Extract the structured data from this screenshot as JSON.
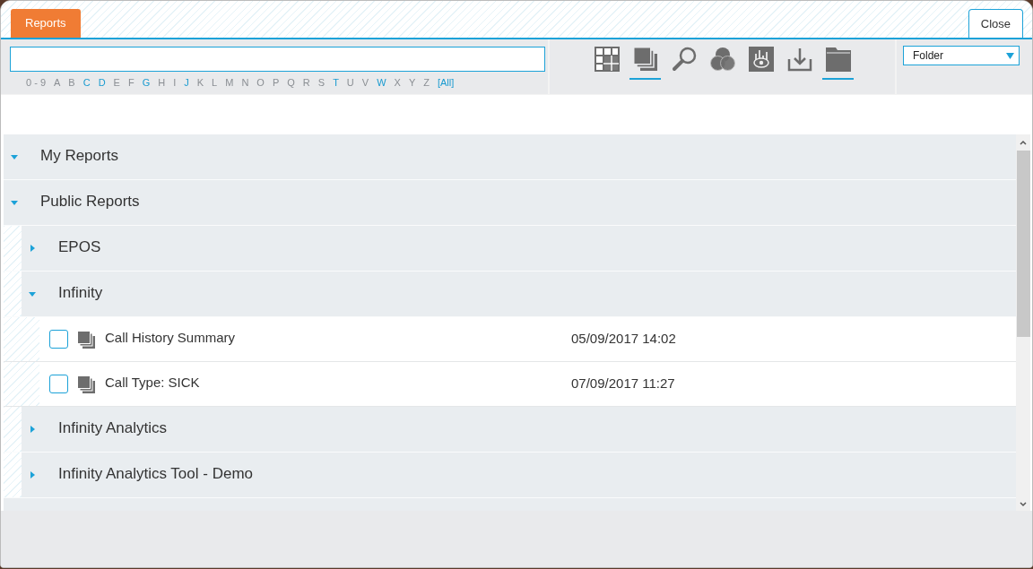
{
  "tabs": [
    {
      "label": "Reports",
      "selected": true
    }
  ],
  "close_button": "Close",
  "alphabet": [
    {
      "label": "0 - 9",
      "disabled": true
    },
    {
      "label": "A",
      "disabled": true
    },
    {
      "label": "B",
      "disabled": true
    },
    {
      "label": "C",
      "disabled": false
    },
    {
      "label": "D",
      "disabled": false
    },
    {
      "label": "E",
      "disabled": true
    },
    {
      "label": "F",
      "disabled": true
    },
    {
      "label": "G",
      "disabled": false
    },
    {
      "label": "H",
      "disabled": true
    },
    {
      "label": "I",
      "disabled": true
    },
    {
      "label": "J",
      "disabled": false
    },
    {
      "label": "K",
      "disabled": true
    },
    {
      "label": "L",
      "disabled": true
    },
    {
      "label": "M",
      "disabled": true
    },
    {
      "label": "N",
      "disabled": true
    },
    {
      "label": "O",
      "disabled": true
    },
    {
      "label": "P",
      "disabled": true
    },
    {
      "label": "Q",
      "disabled": true
    },
    {
      "label": "R",
      "disabled": true
    },
    {
      "label": "S",
      "disabled": true
    },
    {
      "label": "T",
      "disabled": false
    },
    {
      "label": "U",
      "disabled": true
    },
    {
      "label": "V",
      "disabled": true
    },
    {
      "label": "W",
      "disabled": false
    },
    {
      "label": "X",
      "disabled": true
    },
    {
      "label": "Y",
      "disabled": true
    },
    {
      "label": "Z",
      "disabled": true
    },
    {
      "label": "[All]",
      "disabled": false
    }
  ],
  "toolbar": [
    {
      "kind": "grid",
      "selected": false
    },
    {
      "kind": "stack",
      "selected": true
    },
    {
      "kind": "search",
      "selected": false
    },
    {
      "kind": "venn",
      "selected": false
    },
    {
      "kind": "eye",
      "selected": false
    },
    {
      "kind": "download",
      "selected": false
    },
    {
      "kind": "folder",
      "selected": true
    }
  ],
  "view_select": {
    "value": "Folder"
  },
  "tree": [
    {
      "kind": "folder",
      "label": "My Reports",
      "expanded": true
    },
    {
      "kind": "folder",
      "label": "Public Reports",
      "expanded": true,
      "children": [
        {
          "kind": "folder",
          "label": "EPOS",
          "expanded": false
        },
        {
          "kind": "folder",
          "label": "Infinity",
          "expanded": true,
          "children": [
            {
              "kind": "report",
              "label": "Call History Summary",
              "date": "05/09/2017 14:02",
              "checked": false
            },
            {
              "kind": "report",
              "label": "Call Type: SICK",
              "date": "07/09/2017 11:27",
              "checked": false
            }
          ]
        },
        {
          "kind": "folder",
          "label": "Infinity Analytics",
          "expanded": false
        },
        {
          "kind": "folder",
          "label": "Infinity Analytics Tool - Demo",
          "expanded": false
        }
      ]
    }
  ]
}
